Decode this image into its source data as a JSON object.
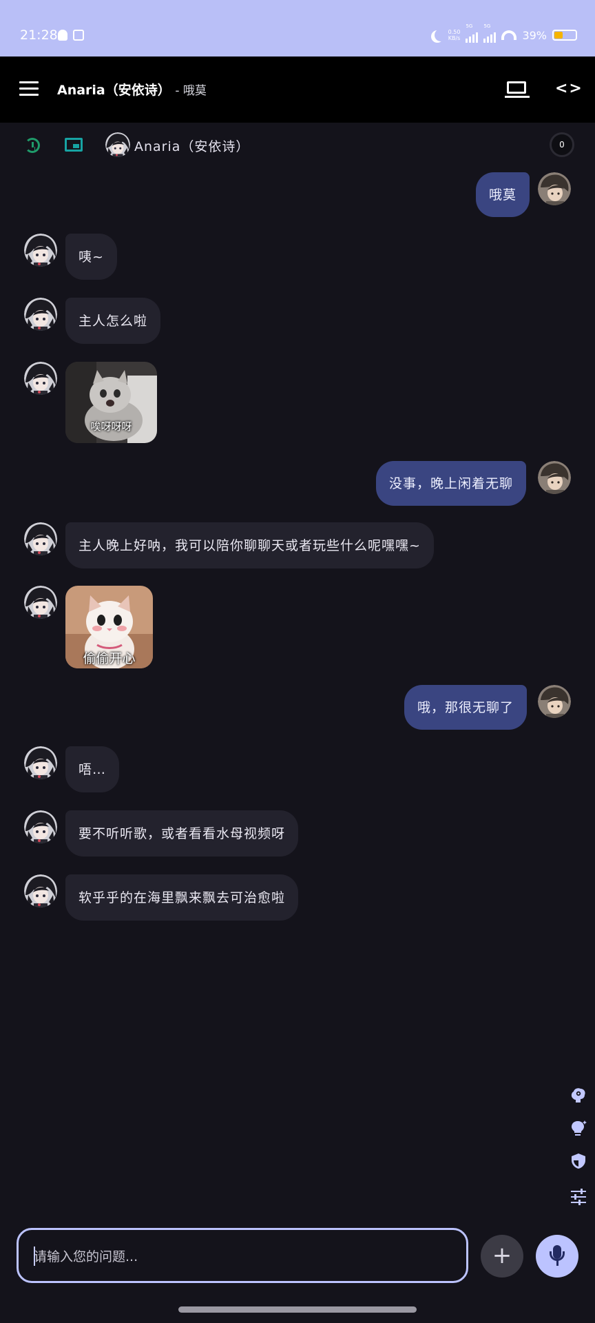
{
  "status_bar": {
    "time": "21:28",
    "net_speed_value": "0.50",
    "net_speed_unit": "KB/s",
    "sim1_label": "5G",
    "sim2_label": "5G",
    "battery_text": "39%",
    "battery_level": 0.39
  },
  "app_bar": {
    "title": "Anaria（安依诗）",
    "subtitle": "- 哦莫",
    "icons": [
      "menu-icon",
      "laptop-icon",
      "code-icon"
    ]
  },
  "toolbar": {
    "character_name": "Anaria（安依诗）",
    "counter": "0",
    "icons": [
      "history-icon",
      "picture-in-picture-icon"
    ]
  },
  "messages": [
    {
      "role": "user",
      "type": "text",
      "text": "哦莫"
    },
    {
      "role": "bot",
      "type": "text",
      "text": "咦~"
    },
    {
      "role": "bot",
      "type": "text",
      "text": "主人怎么啦"
    },
    {
      "role": "bot",
      "type": "sticker",
      "caption": "唉呀呀呀"
    },
    {
      "role": "user",
      "type": "text",
      "text": "没事，晚上闲着无聊"
    },
    {
      "role": "bot",
      "type": "text",
      "text": "主人晚上好呐，我可以陪你聊聊天或者玩些什么呢嘿嘿~"
    },
    {
      "role": "bot",
      "type": "sticker",
      "caption": "偷偷开心"
    },
    {
      "role": "user",
      "type": "text",
      "text": "哦，那很无聊了"
    },
    {
      "role": "bot",
      "type": "text",
      "text": "唔…"
    },
    {
      "role": "bot",
      "type": "text",
      "text": "要不听听歌，或者看看水母视频呀"
    },
    {
      "role": "bot",
      "type": "text",
      "text": "软乎乎的在海里飘来飘去可治愈啦"
    }
  ],
  "side_tools": [
    "brain-settings-icon",
    "lightbulb-icon",
    "shield-icon",
    "tune-icon"
  ],
  "composer": {
    "placeholder": "请输入您的问题...",
    "value": "",
    "add_label": "+"
  },
  "colors": {
    "background": "#14131b",
    "status_bar": "#b9bff7",
    "bot_bubble": "#23222d",
    "user_bubble": "#3a4581",
    "accent": "#bcc3ff",
    "history_icon": "#1f9b6a",
    "pip_icon": "#17a3a3"
  }
}
